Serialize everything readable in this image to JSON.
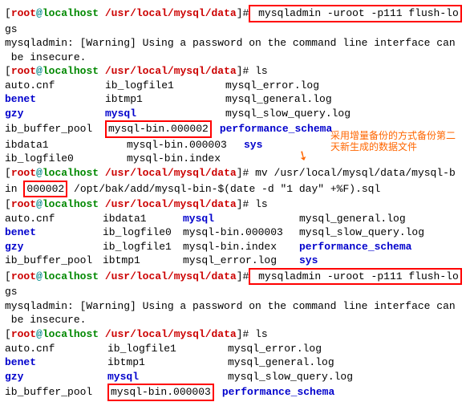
{
  "user": "root",
  "at": "@",
  "host": "localhost",
  "path": "/usr/local/mysql/data",
  "prompt_end": "]#",
  "cmd1": " mysqladmin -uroot -p111 flush-lo",
  "cmd1_wrap": "gs",
  "warn_a": "mysqladmin: [Warning] Using a password on the command line interface can",
  "warn_b": " be insecure.",
  "cmd_ls": " ls",
  "ls1": {
    "c1": "auto.cnf",
    "c2": "ib_logfile1",
    "c3": "mysql_error.log",
    "c4": "benet",
    "c5": "ibtmp1",
    "c6": "mysql_general.log",
    "c7": "gzy",
    "c8": "mysql",
    "c9": "mysql_slow_query.log",
    "c10": "ib_buffer_pool",
    "c11": "mysql-bin.000002",
    "c12": "performance_schema",
    "c13": "ibdata1",
    "c14": "mysql-bin.000003",
    "c15": "sys",
    "c16": "ib_logfile0",
    "c17": "mysql-bin.index"
  },
  "cmd2a": " mv /usr/local/mysql/data/mysql-b",
  "cmd2b_pre": "in ",
  "cmd2b_box": "000002",
  "cmd2b_post": " /opt/bak/add/mysql-bin-$(date -d \"1 day\" +%F).sql",
  "ls2": {
    "r1c1": "auto.cnf",
    "r1c2": "ibdata1",
    "r1c3": "mysql",
    "r1c4": "mysql_general.log",
    "r2c1": "benet",
    "r2c2": "ib_logfile0",
    "r2c3": "mysql-bin.000003",
    "r2c4": "mysql_slow_query.log",
    "r3c1": "gzy",
    "r3c2": "ib_logfile1",
    "r3c3": "mysql-bin.index",
    "r3c4": "performance_schema",
    "r4c1": "ib_buffer_pool",
    "r4c2": "ibtmp1",
    "r4c3": "mysql_error.log",
    "r4c4": "sys"
  },
  "ls3": {
    "r1c1": "auto.cnf",
    "r1c2": "ib_logfile1",
    "r1c3": "mysql_error.log",
    "r2c1": "benet",
    "r2c2": "ibtmp1",
    "r2c3": "mysql_general.log",
    "r3c1": "gzy",
    "r3c2": "mysql",
    "r3c3": "mysql_slow_query.log",
    "r4c1": "ib_buffer_pool",
    "r4c2": "mysql-bin.000003",
    "r4c3": "performance_schema"
  },
  "annotation_l1": "采用增量备份的方式备份第二",
  "annotation_l2": "天新生成的数据文件",
  "bracket_open": "[",
  "bracket_close": "",
  "sp_hash": " "
}
